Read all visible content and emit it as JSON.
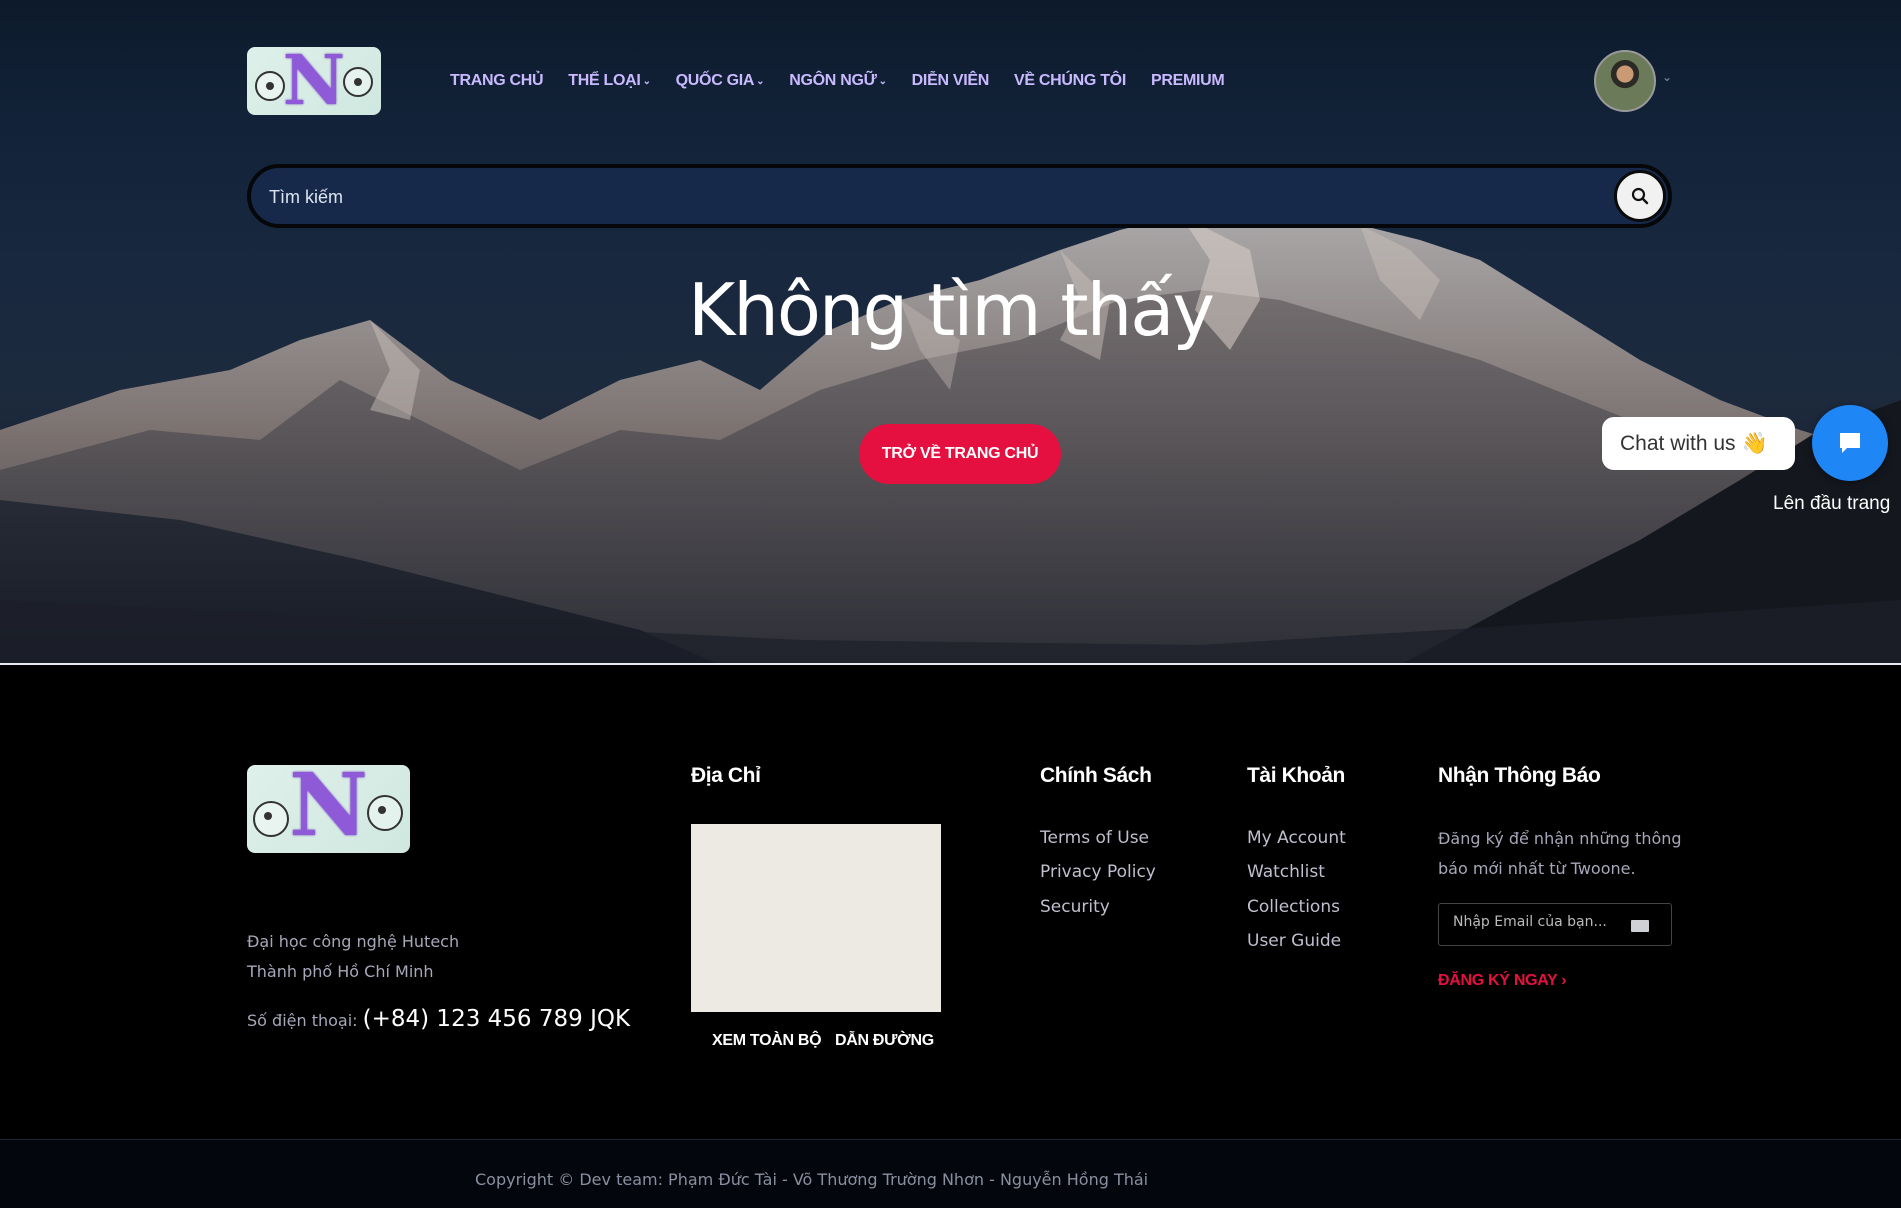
{
  "header": {
    "logo_alt": "TN logo",
    "logo_letter": "N",
    "nav": [
      {
        "label": "TRANG CHỦ",
        "dropdown": false
      },
      {
        "label": "THỂ LOẠI",
        "dropdown": true
      },
      {
        "label": "QUỐC GIA",
        "dropdown": true
      },
      {
        "label": "NGÔN NGỮ",
        "dropdown": true
      },
      {
        "label": "DIỄN VIÊN",
        "dropdown": false
      },
      {
        "label": "VỀ CHÚNG TÔI",
        "dropdown": false
      },
      {
        "label": "PREMIUM",
        "dropdown": false
      }
    ],
    "search_placeholder": "Tìm kiếm"
  },
  "hero": {
    "title": "Không tìm thấy",
    "home_button": "TRỞ VỀ TRANG CHỦ"
  },
  "chat": {
    "bubble_text": "Chat with us",
    "bubble_emoji": "👋",
    "back_to_top": "Lên đầu trang"
  },
  "footer": {
    "address_lines": [
      "Đại học công nghệ Hutech",
      "Thành phố Hồ Chí Minh"
    ],
    "phone_label": "Số điện thoại:",
    "phone_value": "(+84) 123 456 789 JQK",
    "address_title": "Địa Chỉ",
    "map_links": [
      "XEM TOÀN BỘ",
      "DẪN ĐƯỜNG"
    ],
    "policy_title": "Chính Sách",
    "policy_links": [
      "Terms of Use",
      "Privacy Policy",
      "Security"
    ],
    "account_title": "Tài Khoản",
    "account_links": [
      "My Account",
      "Watchlist",
      "Collections",
      "User Guide"
    ],
    "newsletter_title": "Nhận Thông Báo",
    "newsletter_text_lines": [
      "Đăng ký để nhận những thông",
      "báo mới nhất từ Twoone."
    ],
    "email_placeholder": "Nhập Email của bạn...",
    "subscribe_label": "ĐĂNG KÝ NGAY",
    "copyright": "Copyright © Dev team: Phạm Đức Tài - Võ Thương Trường Nhơn - Nguyễn Hồng Thái"
  },
  "colors": {
    "accent": "#e5103f",
    "nav_text": "#c9b9ff",
    "chat_blue": "#1f87f5",
    "search_bg": "#16294a"
  }
}
